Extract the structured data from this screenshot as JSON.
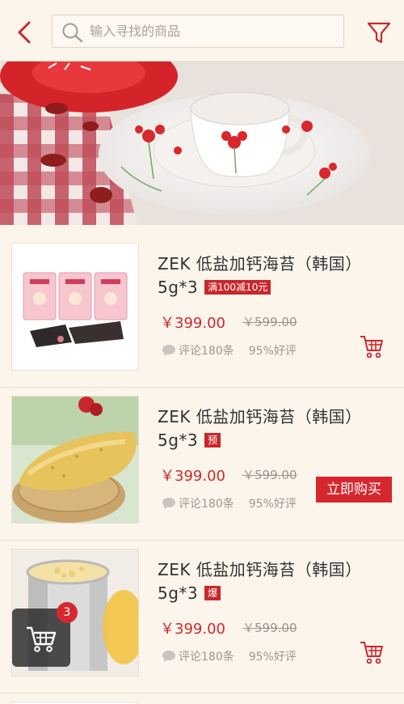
{
  "header": {
    "search_placeholder": "输入寻找的商品"
  },
  "products": [
    {
      "title": "ZEK 低盐加钙海苔（韩国）5g*3",
      "tag": "满100减10元",
      "price": "￥399.00",
      "old_price": "￥599.00",
      "comments": "评论180条",
      "rating": "95%好评",
      "action": "cart"
    },
    {
      "title": "ZEK 低盐加钙海苔（韩国）5g*3",
      "tag": "预",
      "price": "￥399.00",
      "old_price": "￥599.00",
      "comments": "评论180条",
      "rating": "95%好评",
      "action": "buy",
      "buy_label": "立即购买"
    },
    {
      "title": "ZEK 低盐加钙海苔（韩国）5g*3",
      "tag": "爆",
      "price": "￥399.00",
      "old_price": "￥599.00",
      "comments": "评论180条",
      "rating": "95%好评",
      "action": "cart"
    }
  ],
  "floating_cart": {
    "count": "3"
  },
  "colors": {
    "accent": "#d0282d",
    "background": "#fcf5ec"
  }
}
